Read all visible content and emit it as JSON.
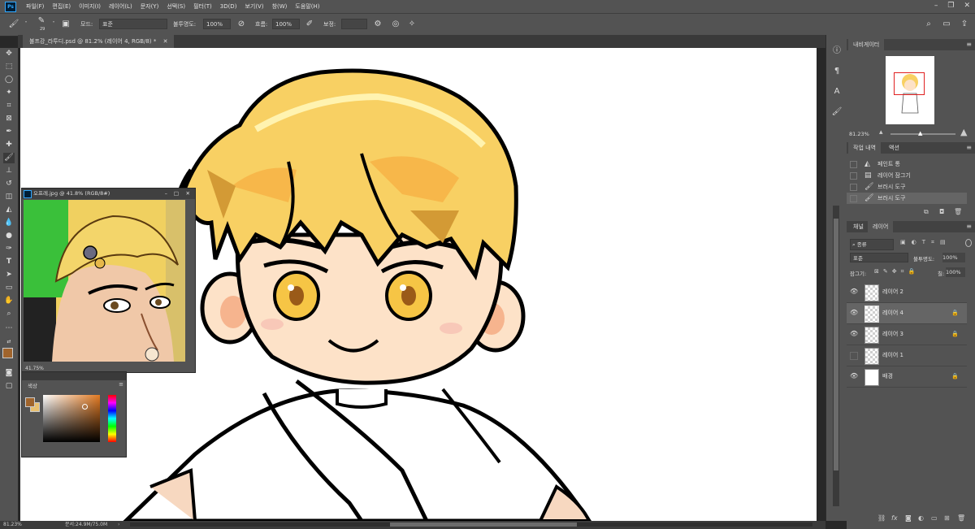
{
  "menubar": {
    "app_icon": "Ps",
    "items": [
      "파일(F)",
      "편집(E)",
      "이미지(I)",
      "레이어(L)",
      "문자(Y)",
      "선택(S)",
      "필터(T)",
      "3D(D)",
      "보기(V)",
      "창(W)",
      "도움말(H)"
    ]
  },
  "options": {
    "brush_size": "29",
    "mode_label": "모드:",
    "mode_value": "표준",
    "opacity_label": "불투명도:",
    "opacity_value": "100%",
    "flow_label": "흐름:",
    "flow_value": "100%",
    "smoothing_label": "보정:"
  },
  "document": {
    "tab_title": "불프강_라투디.psd @ 81.2% (레이어 4, RGB/8) *",
    "zoom": "81.23%",
    "doc_size": "문서:24.9M/75.0M"
  },
  "reference_window": {
    "title": "오프레.jpg @ 41.8% (RGB/8#)",
    "zoom": "41.75%"
  },
  "color_panel": {
    "title": "색상"
  },
  "navigator": {
    "title": "내비게이터",
    "zoom": "81.23%"
  },
  "history": {
    "tabs": [
      "작업 내역",
      "액션"
    ],
    "items": [
      {
        "label": "페인트 통",
        "icon": "paint-bucket-icon"
      },
      {
        "label": "레이어 잠그기",
        "icon": "history-state-icon"
      },
      {
        "label": "브러시 도구",
        "icon": "brush-icon"
      },
      {
        "label": "브러시 도구",
        "icon": "brush-icon"
      }
    ]
  },
  "layers_panel": {
    "tabs": [
      "채널",
      "레이어"
    ],
    "filter_label": "종류",
    "blend_mode": "표준",
    "opacity_label": "불투명도:",
    "opacity_value": "100%",
    "lock_label": "잠그기:",
    "fill_label": "칠:",
    "fill_value": "100%",
    "layers": [
      {
        "name": "레이어 2",
        "visible": true,
        "locked": false,
        "selected": false
      },
      {
        "name": "레이어 4",
        "visible": true,
        "locked": true,
        "selected": true
      },
      {
        "name": "레이어 3",
        "visible": true,
        "locked": true,
        "selected": false
      },
      {
        "name": "레이어 1",
        "visible": false,
        "locked": false,
        "selected": false
      },
      {
        "name": "배경",
        "visible": true,
        "locked": true,
        "selected": false
      }
    ]
  },
  "colors": {
    "foreground": "#a0642c",
    "background": "#e8c070",
    "ui_panel": "#535353",
    "selection": "#656565"
  }
}
